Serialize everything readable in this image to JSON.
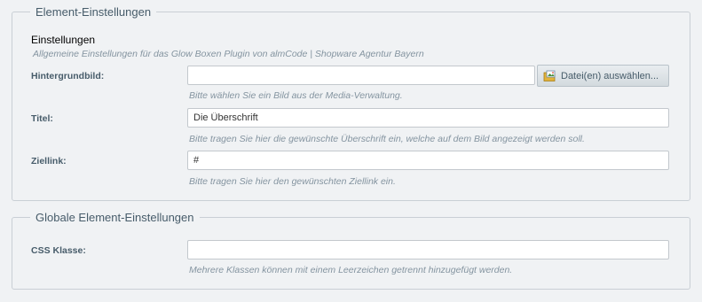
{
  "element_settings": {
    "legend": "Element-Einstellungen",
    "section_title": "Einstellungen",
    "section_description": "Allgemeine Einstellungen für das Glow Boxen Plugin von almCode | Shopware Agentur Bayern",
    "background": {
      "label": "Hintergrundbild:",
      "value": "",
      "button_label": "Datei(en) auswählen...",
      "button_icon": "image-folder-icon",
      "help": "Bitte wählen Sie ein Bild aus der Media-Verwaltung."
    },
    "title": {
      "label": "Titel:",
      "value": "Die Überschrift",
      "help": "Bitte tragen Sie hier die gewünschte Überschrift ein, welche auf dem Bild angezeigt werden soll."
    },
    "target_link": {
      "label": "Ziellink:",
      "value": "#",
      "help": "Bitte tragen Sie hier den gewünschten Ziellink ein."
    }
  },
  "global_settings": {
    "legend": "Globale Element-Einstellungen",
    "css_class": {
      "label": "CSS Klasse:",
      "value": "",
      "help": "Mehrere Klassen können mit einem Leerzeichen getrennt hinzugefügt werden."
    }
  }
}
